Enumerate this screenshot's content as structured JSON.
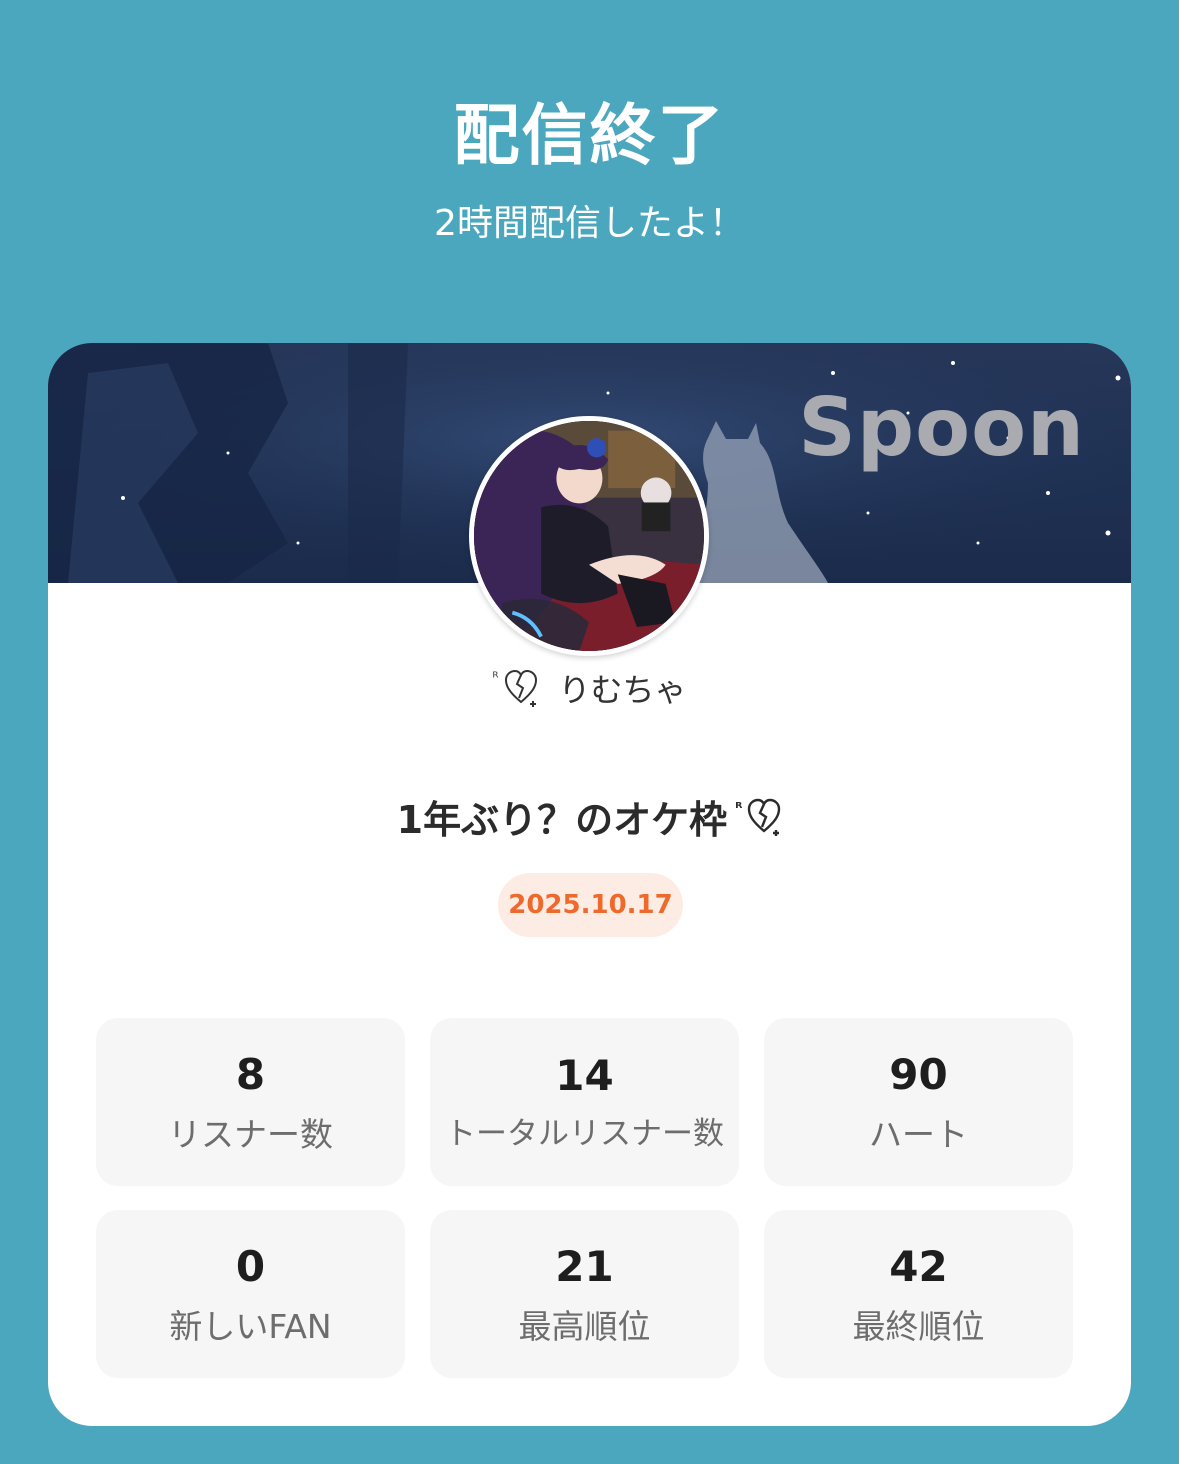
{
  "header": {
    "title": "配信終了",
    "subtitle": "2時間配信したよ！"
  },
  "card": {
    "brand": "Spoon",
    "avatar_icon": "profile-avatar",
    "username_prefix": "ᴿ",
    "username": "りむちゃ",
    "stream_title": "1年ぶり？のオケ枠",
    "stream_title_suffix": "ᴿ",
    "date": "2025.10.17",
    "date_color": "#ee6a2c"
  },
  "stats": [
    {
      "value": "8",
      "label": "リスナー数"
    },
    {
      "value": "14",
      "label": "トータルリスナー数"
    },
    {
      "value": "90",
      "label": "ハート"
    },
    {
      "value": "0",
      "label": "新しいFAN"
    },
    {
      "value": "21",
      "label": "最高順位"
    },
    {
      "value": "42",
      "label": "最終順位"
    }
  ],
  "colors": {
    "background": "#4ba7be",
    "card": "#ffffff",
    "banner": "#1f3153",
    "stat_tile": "#f6f6f6"
  }
}
